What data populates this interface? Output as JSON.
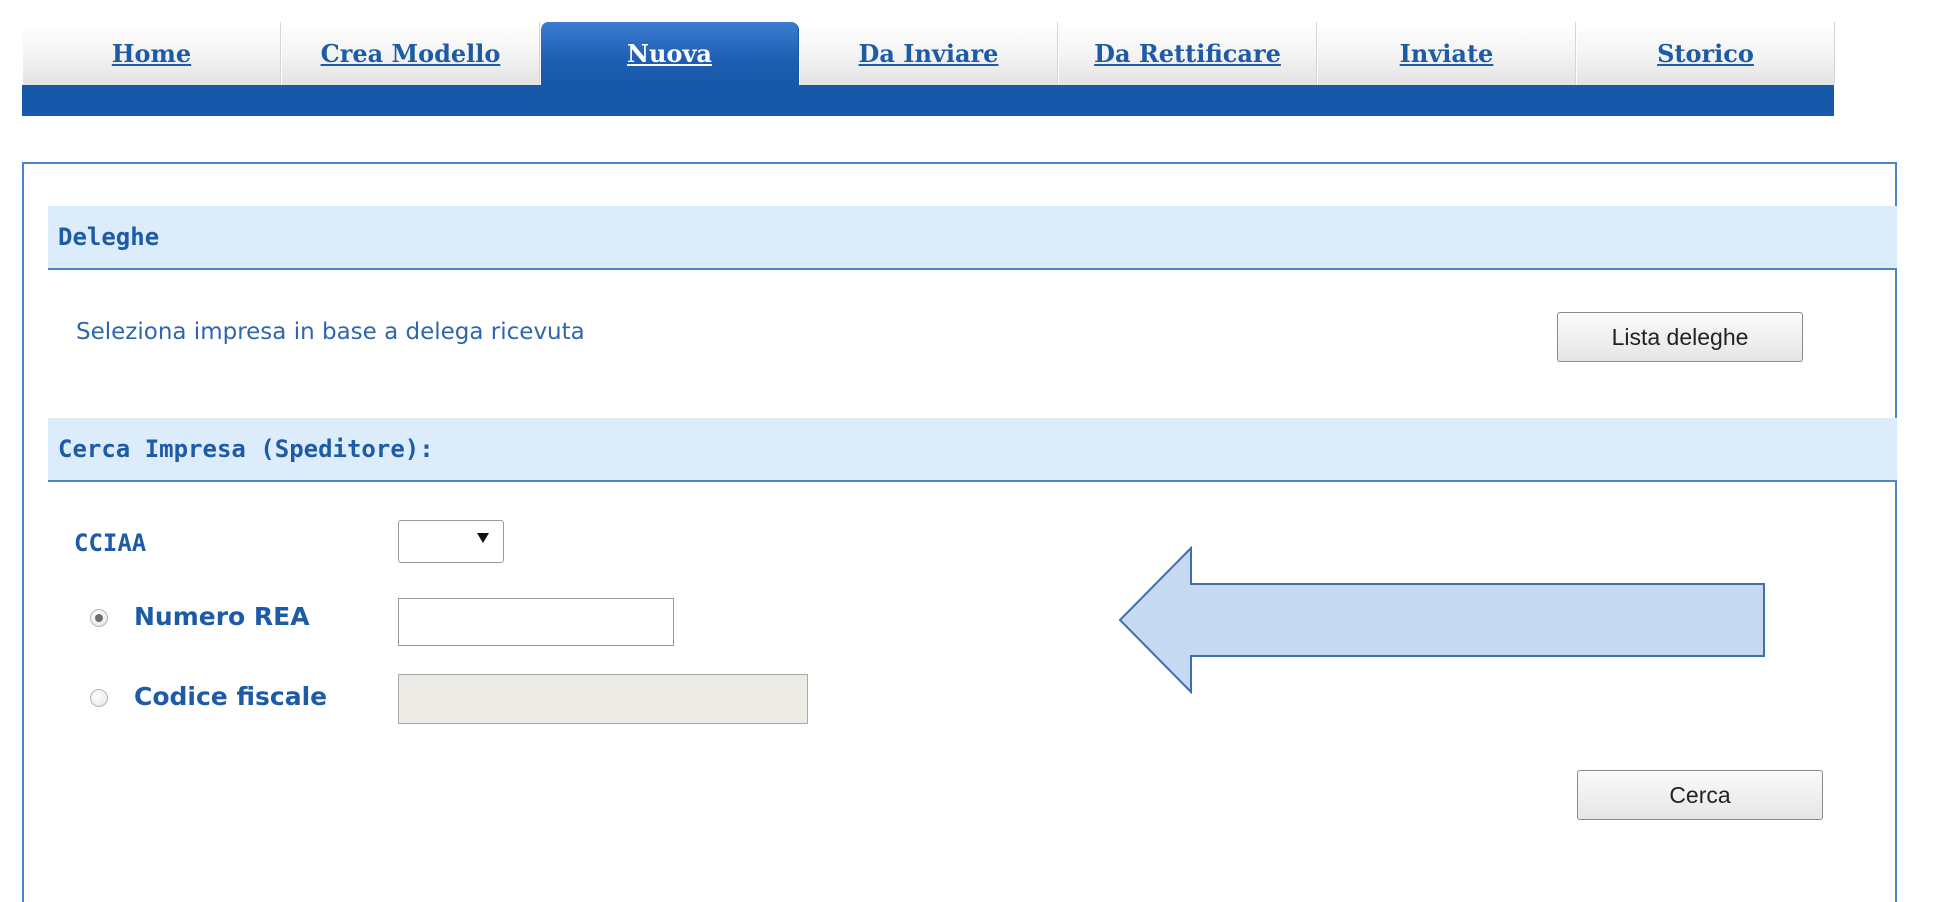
{
  "tabs": [
    {
      "label": "Home",
      "active": false
    },
    {
      "label": "Crea Modello",
      "active": false
    },
    {
      "label": "Nuova",
      "active": true
    },
    {
      "label": "Da Inviare",
      "active": false
    },
    {
      "label": "Da Rettificare",
      "active": false
    },
    {
      "label": "Inviate",
      "active": false
    },
    {
      "label": "Storico",
      "active": false
    }
  ],
  "deleghe": {
    "title": "Deleghe",
    "hint": "Seleziona impresa in base a delega ricevuta",
    "button_label": "Lista deleghe"
  },
  "search": {
    "title": "Cerca Impresa (Speditore):",
    "cciaa_label": "CCIAA",
    "cciaa_value": "",
    "numero_rea_label": "Numero REA",
    "numero_rea_value": "",
    "numero_rea_selected": true,
    "codice_fiscale_label": "Codice fiscale",
    "codice_fiscale_value": "",
    "codice_fiscale_selected": false,
    "button_label": "Cerca"
  },
  "colors": {
    "accent_blue": "#1758aa",
    "link_blue": "#1d5ba6",
    "section_bg": "#dcecfa",
    "arrow_fill": "#c6d9f1",
    "arrow_stroke": "#3e6fae"
  },
  "icons": {
    "arrow": "left-arrow-annotation",
    "caret": "caret-down-icon"
  }
}
